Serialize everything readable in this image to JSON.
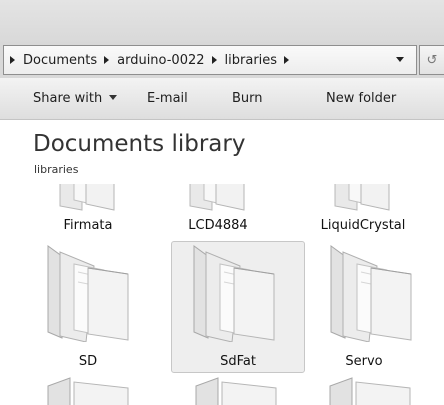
{
  "breadcrumb": {
    "items": [
      "Documents",
      "arduino-0022",
      "libraries"
    ]
  },
  "toolbar": {
    "share_with": "Share with",
    "email": "E-mail",
    "burn": "Burn",
    "new_folder": "New folder"
  },
  "library": {
    "title": "Documents library",
    "subtitle": "libraries"
  },
  "folders": {
    "row1": [
      "Firmata",
      "LCD4884",
      "LiquidCrystal"
    ],
    "row2": [
      "SD",
      "SdFat",
      "Servo"
    ],
    "selected": "SdFat"
  },
  "icons": {
    "refresh": "refresh-icon",
    "folder": "folder-icon"
  },
  "colors": {
    "selection_background": "#eeeeee",
    "toolbar_gradient_top": "#f3f3f3",
    "toolbar_gradient_bottom": "#dedede"
  }
}
